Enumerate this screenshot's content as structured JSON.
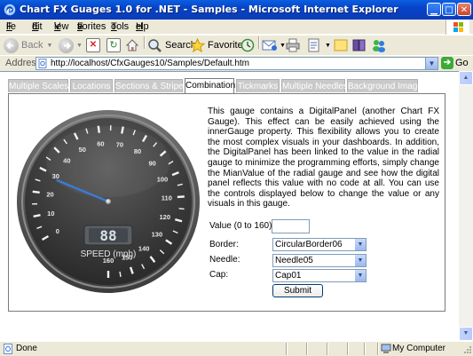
{
  "window": {
    "title": "Chart FX Guages 1.0 for .NET - Samples - Microsoft Internet Explorer",
    "icon": "ie-icon"
  },
  "menu": {
    "items": [
      {
        "pre": "",
        "u": "F",
        "post": "ile"
      },
      {
        "pre": "",
        "u": "E",
        "post": "dit"
      },
      {
        "pre": "",
        "u": "V",
        "post": "iew"
      },
      {
        "pre": "F",
        "u": "a",
        "post": "vorites"
      },
      {
        "pre": "",
        "u": "T",
        "post": "ools"
      },
      {
        "pre": "",
        "u": "H",
        "post": "elp"
      }
    ]
  },
  "toolbar": {
    "back_label": "Back",
    "search_label": "Search",
    "favorites_label": "Favorites"
  },
  "address": {
    "label": "Address",
    "url": "http://localhost/CfxGauges10/Samples/Default.htm",
    "go_label": "Go"
  },
  "tabs": [
    {
      "label": "Multiple Scales",
      "active": false
    },
    {
      "label": "Locations",
      "active": false
    },
    {
      "label": "Sections & Stripes",
      "active": false
    },
    {
      "label": "Combination",
      "active": true
    },
    {
      "label": "Tickmarks",
      "active": false
    },
    {
      "label": "Multiple Needles",
      "active": false
    },
    {
      "label": "Background Image",
      "active": false
    }
  ],
  "gauge": {
    "scale_labels": [
      "0",
      "10",
      "20",
      "30",
      "40",
      "50",
      "60",
      "70",
      "80",
      "90",
      "100",
      "110",
      "120",
      "130",
      "140",
      "150",
      "160"
    ],
    "min": 0,
    "max": 160,
    "value": 28,
    "digital_display": "88",
    "caption": "SPEED (mph)"
  },
  "description": "This gauge contains a DigitalPanel (another Chart FX Gauge). This effect can be easily achieved using the innerGauge property. This flexibility allows you to create the most complex visuals in your dashboards. In addition, the DigitalPanel has been linked to the value in the radial gauge to minimize the programming efforts, simply change the MianValue of the radial gauge and see how the digital panel reflects this value with no code at all. You can use the controls displayed below to change the value or any visuals in this gauge.",
  "form": {
    "value_label": "Value (0 to 160):",
    "value_input": "",
    "border_label": "Border:",
    "border_value": "CircularBorder06",
    "needle_label": "Needle:",
    "needle_value": "Needle05",
    "cap_label": "Cap:",
    "cap_value": "Cap01",
    "submit_label": "Submit"
  },
  "status": {
    "text": "Done",
    "zone": "My Computer"
  }
}
